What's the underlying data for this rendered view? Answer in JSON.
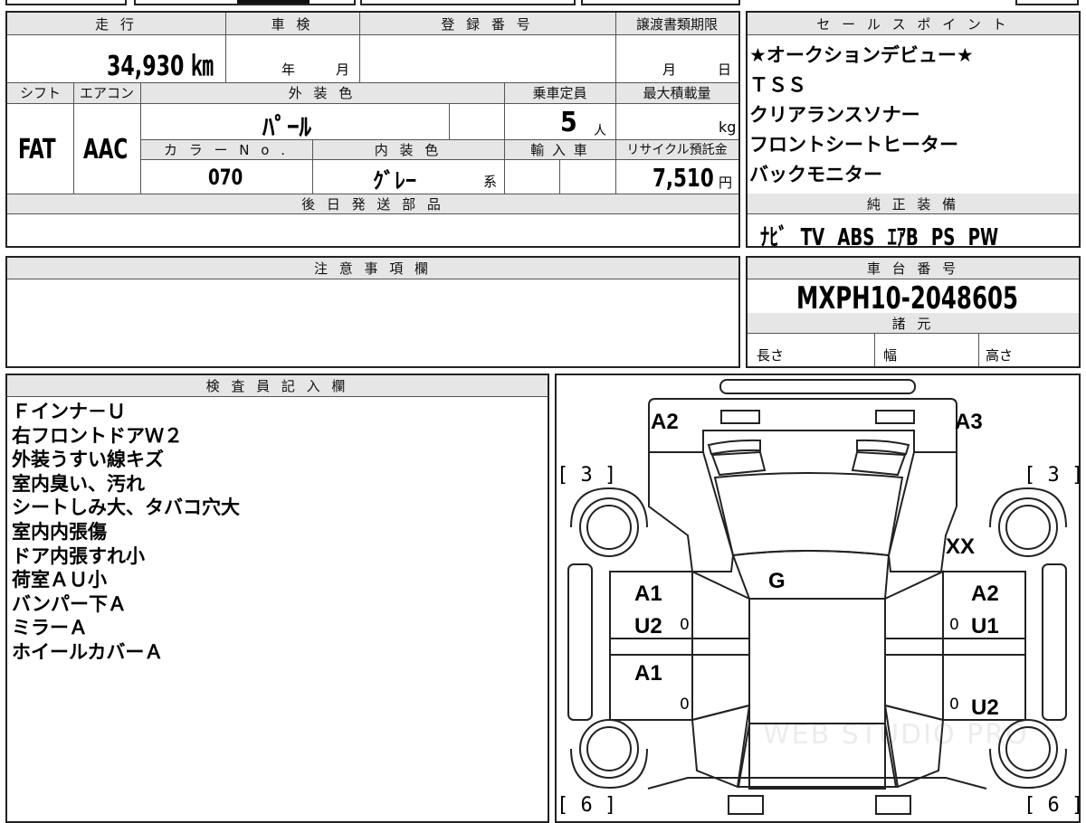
{
  "top_strip": [
    "",
    "",
    "",
    ""
  ],
  "labels": {
    "mileage": "走 行",
    "shaken": "車 検",
    "registration_no": "登 録 番 号",
    "transfer_deadline": "譲渡書類期限",
    "shift": "シフト",
    "aircon": "エアコン",
    "exterior_color": "外 装 色",
    "capacity": "乗車定員",
    "max_load": "最大積載量",
    "color_no": "カ ラ ー N o .",
    "interior_color": "内 装 色",
    "import": "輸 入 車",
    "recycle_fee": "リサイクル預託金",
    "later_parts": "後 日 発 送 部 品",
    "caution": "注 意 事 項 欄",
    "inspector": "検 査 員 記 入 欄",
    "sales_points": "セ ー ル ス ポ イ ン ト",
    "genuine_equipment": "純 正 装 備",
    "chassis_no": "車 台 番 号",
    "specs": "諸 元",
    "length": "長さ",
    "width": "幅",
    "height": "高さ"
  },
  "units": {
    "year": "年",
    "month": "月",
    "day": "日",
    "persons": "人",
    "kg": "kg",
    "yen": "円",
    "series": "系"
  },
  "vehicle": {
    "mileage": "34,930 ㎞",
    "registration_no": "",
    "shift": "FAT",
    "aircon": "AAC",
    "exterior_color": "ﾊﾟｰﾙ",
    "capacity": "5",
    "max_load": "",
    "color_no": "070",
    "interior_color": "ｸﾞﾚｰ",
    "recycle_fee": "7,510",
    "chassis_no": "MXPH10-2048605"
  },
  "sales_points": [
    "★オークションデビュー★",
    "ＴＳＳ",
    "クリアランスソナー",
    "フロントシートヒーター",
    "バックモニター"
  ],
  "genuine_equipment": "ﾅﾋﾞ TV ABS ｴｱB PS PW",
  "inspector_notes": [
    "Ｆインナ－Ｕ",
    "右フロントドアＷ２",
    "外装うすい線キズ",
    "室内臭い、汚れ",
    "シートしみ大、タバコ穴大",
    "室内内張傷",
    "ドア内張すれ小",
    "荷室ＡＵ小",
    "バンパー下Ａ",
    "ミラーＡ",
    "ホイールカバーＡ"
  ],
  "diagram": {
    "front_left": "A2",
    "front_right": "A3",
    "bracket_tl": "[ 3 ]",
    "bracket_tr": "[ 3 ]",
    "bracket_bl": "[ 6 ]",
    "bracket_br": "[ 6 ]",
    "windshield": "G",
    "right_fender": "XX",
    "left_front_door": [
      "A1",
      "U2"
    ],
    "right_front_door": [
      "A2",
      "U1"
    ],
    "left_rear_door": [
      "A1"
    ],
    "right_rear_door": [
      "U2"
    ],
    "door_marks": [
      "0",
      "0",
      "0",
      "0"
    ],
    "watermark": "WEB STUDIO PRO"
  }
}
